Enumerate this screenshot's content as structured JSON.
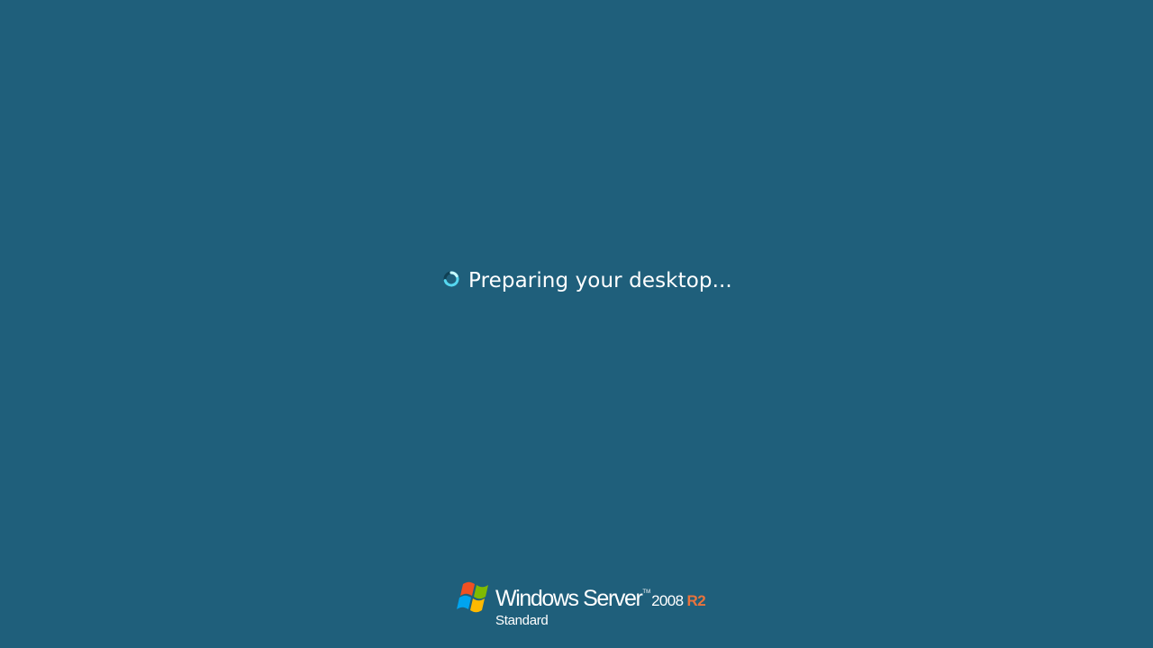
{
  "screen": {
    "background_color": "#1f5f7b"
  },
  "status": {
    "icon": "busy-spinner-icon",
    "text": "Preparing your desktop..."
  },
  "branding": {
    "logo_icon": "windows-flag-icon",
    "product": "Windows Server",
    "trademark": "TM",
    "year": "2008",
    "release": "R2",
    "release_color": "#e8733d",
    "edition": "Standard"
  }
}
